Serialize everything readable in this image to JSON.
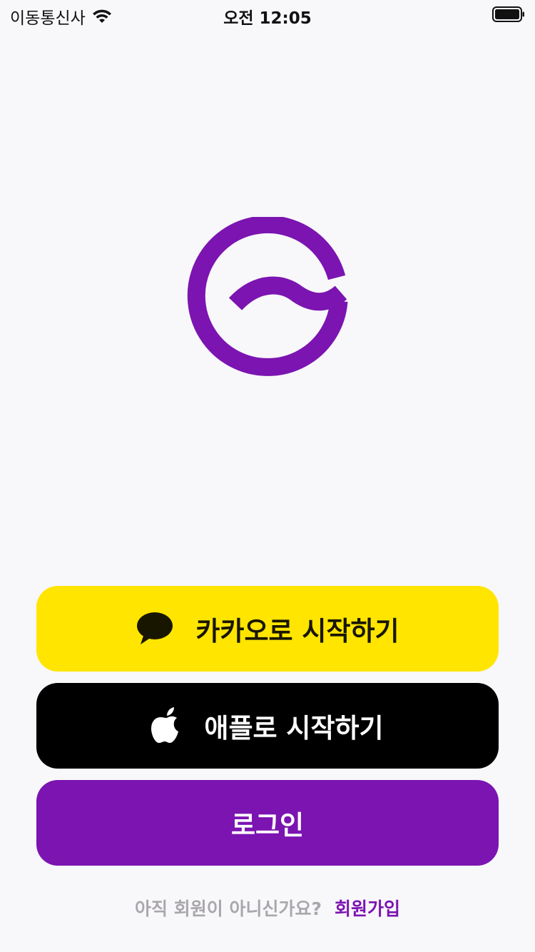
{
  "status_bar": {
    "carrier": "이동통신사",
    "time": "오전 12:05"
  },
  "brand": {
    "logo_icon": "wave-circle-logo",
    "color": "#7b14b1"
  },
  "buttons": {
    "kakao": {
      "label": "카카오로 시작하기",
      "icon": "speech-bubble-icon",
      "color": "#ffe500"
    },
    "apple": {
      "label": "애플로 시작하기",
      "icon": "apple-icon",
      "color": "#000000"
    },
    "login": {
      "label": "로그인",
      "color": "#7b14b1"
    }
  },
  "footer": {
    "question": "아직 회원이 아니신가요?",
    "signup_label": "회원가입"
  }
}
